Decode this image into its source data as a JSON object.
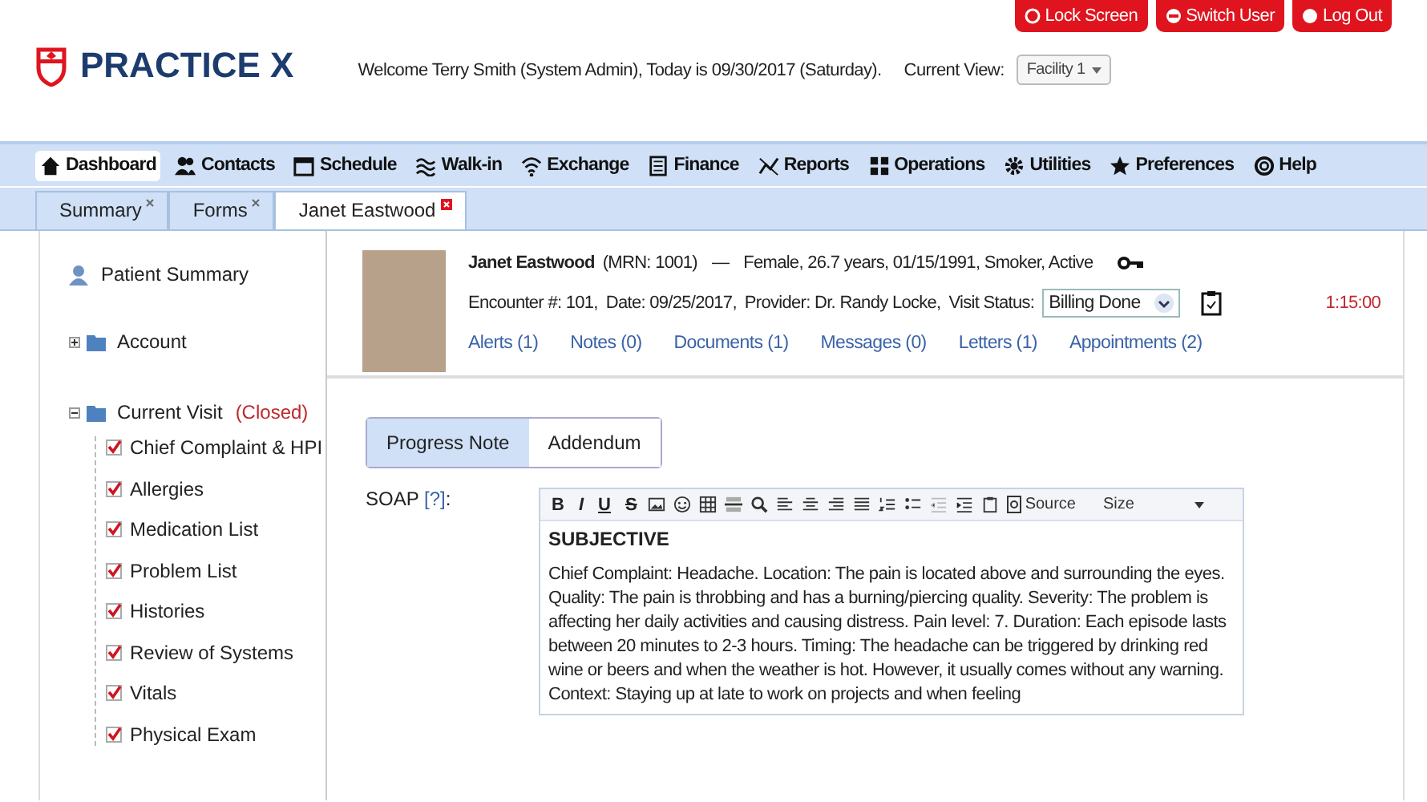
{
  "header": {
    "logo": "PRACTICE X",
    "welcome": "Welcome Terry Smith (System Admin), Today is 09/30/2017 (Saturday).",
    "current_view_label": "Current View:",
    "current_view": "Facility 1",
    "buttons": [
      "Lock Screen",
      "Switch User",
      "Log Out"
    ]
  },
  "nav": [
    {
      "label": "Dashboard",
      "selected": true
    },
    {
      "label": "Contacts",
      "selected": false
    },
    {
      "label": "Schedule",
      "selected": false
    },
    {
      "label": "Walk-in",
      "selected": false
    },
    {
      "label": "Exchange",
      "selected": false
    },
    {
      "label": "Finance",
      "selected": false
    },
    {
      "label": "Reports",
      "selected": false
    },
    {
      "label": "Operations",
      "selected": false
    },
    {
      "label": "Utilities",
      "selected": false
    },
    {
      "label": "Preferences",
      "selected": false
    },
    {
      "label": "Help",
      "selected": false
    }
  ],
  "tabs": [
    {
      "label": "Summary",
      "selected": false
    },
    {
      "label": "Forms",
      "selected": false
    },
    {
      "label": "Janet Eastwood",
      "selected": true
    }
  ],
  "sidebar": {
    "items": [
      {
        "label": "Patient Summary",
        "kind": "summary"
      },
      {
        "label": "Account",
        "kind": "folder",
        "expanded": false
      },
      {
        "label": "Current Visit",
        "status": "(Closed)",
        "kind": "folder",
        "expanded": true,
        "children": [
          {
            "label": "Chief Complaint & HPI",
            "checked": true
          },
          {
            "label": "Allergies",
            "checked": true
          },
          {
            "label": "Medication List",
            "checked": true
          },
          {
            "label": "Problem List",
            "checked": true
          },
          {
            "label": "Histories",
            "checked": true
          },
          {
            "label": "Review of Systems",
            "checked": true
          },
          {
            "label": "Vitals",
            "checked": true
          },
          {
            "label": "Physical Exam",
            "checked": true
          }
        ]
      }
    ]
  },
  "patient": {
    "name": "Janet Eastwood",
    "mrn": "(MRN: 1001)",
    "dash": "—",
    "details": "Female, 26.7 years, 01/15/1991, Smoker, Active",
    "encounter": [
      "Encounter #: 101,",
      "Date: 09/25/2017,",
      "Provider: Dr. Randy Locke,"
    ],
    "visit_status_label": "Visit Status:",
    "visit_status": "Billing Done",
    "timer": "1:15:00",
    "links": [
      "Alerts (1)",
      "Notes (0)",
      "Documents (1)",
      "Messages (0)",
      "Letters (1)",
      "Appointments (2)"
    ]
  },
  "note_tabs": [
    {
      "label": "Progress Note",
      "selected": true
    },
    {
      "label": "Addendum",
      "selected": false
    }
  ],
  "soap": {
    "label": "SOAP",
    "help": "[?]",
    "colon": ":",
    "format_buttons": [
      "B",
      "I",
      "U",
      "S"
    ],
    "source": "Source",
    "size": "Size",
    "heading": "SUBJECTIVE",
    "text": "Chief Complaint: Headache. Location: The pain is located above and surrounding the eyes. Quality: The pain is throbbing and has a burning/piercing quality. Severity: The problem is affecting her daily activities and causing distress. Pain level: 7. Duration: Each episode lasts between 20 minutes to 2-3 hours. Timing: The headache can be triggered by drinking red wine or beers and when the weather is hot. However, it usually comes without any warning. Context: Staying up at late to work on projects and when feeling"
  }
}
